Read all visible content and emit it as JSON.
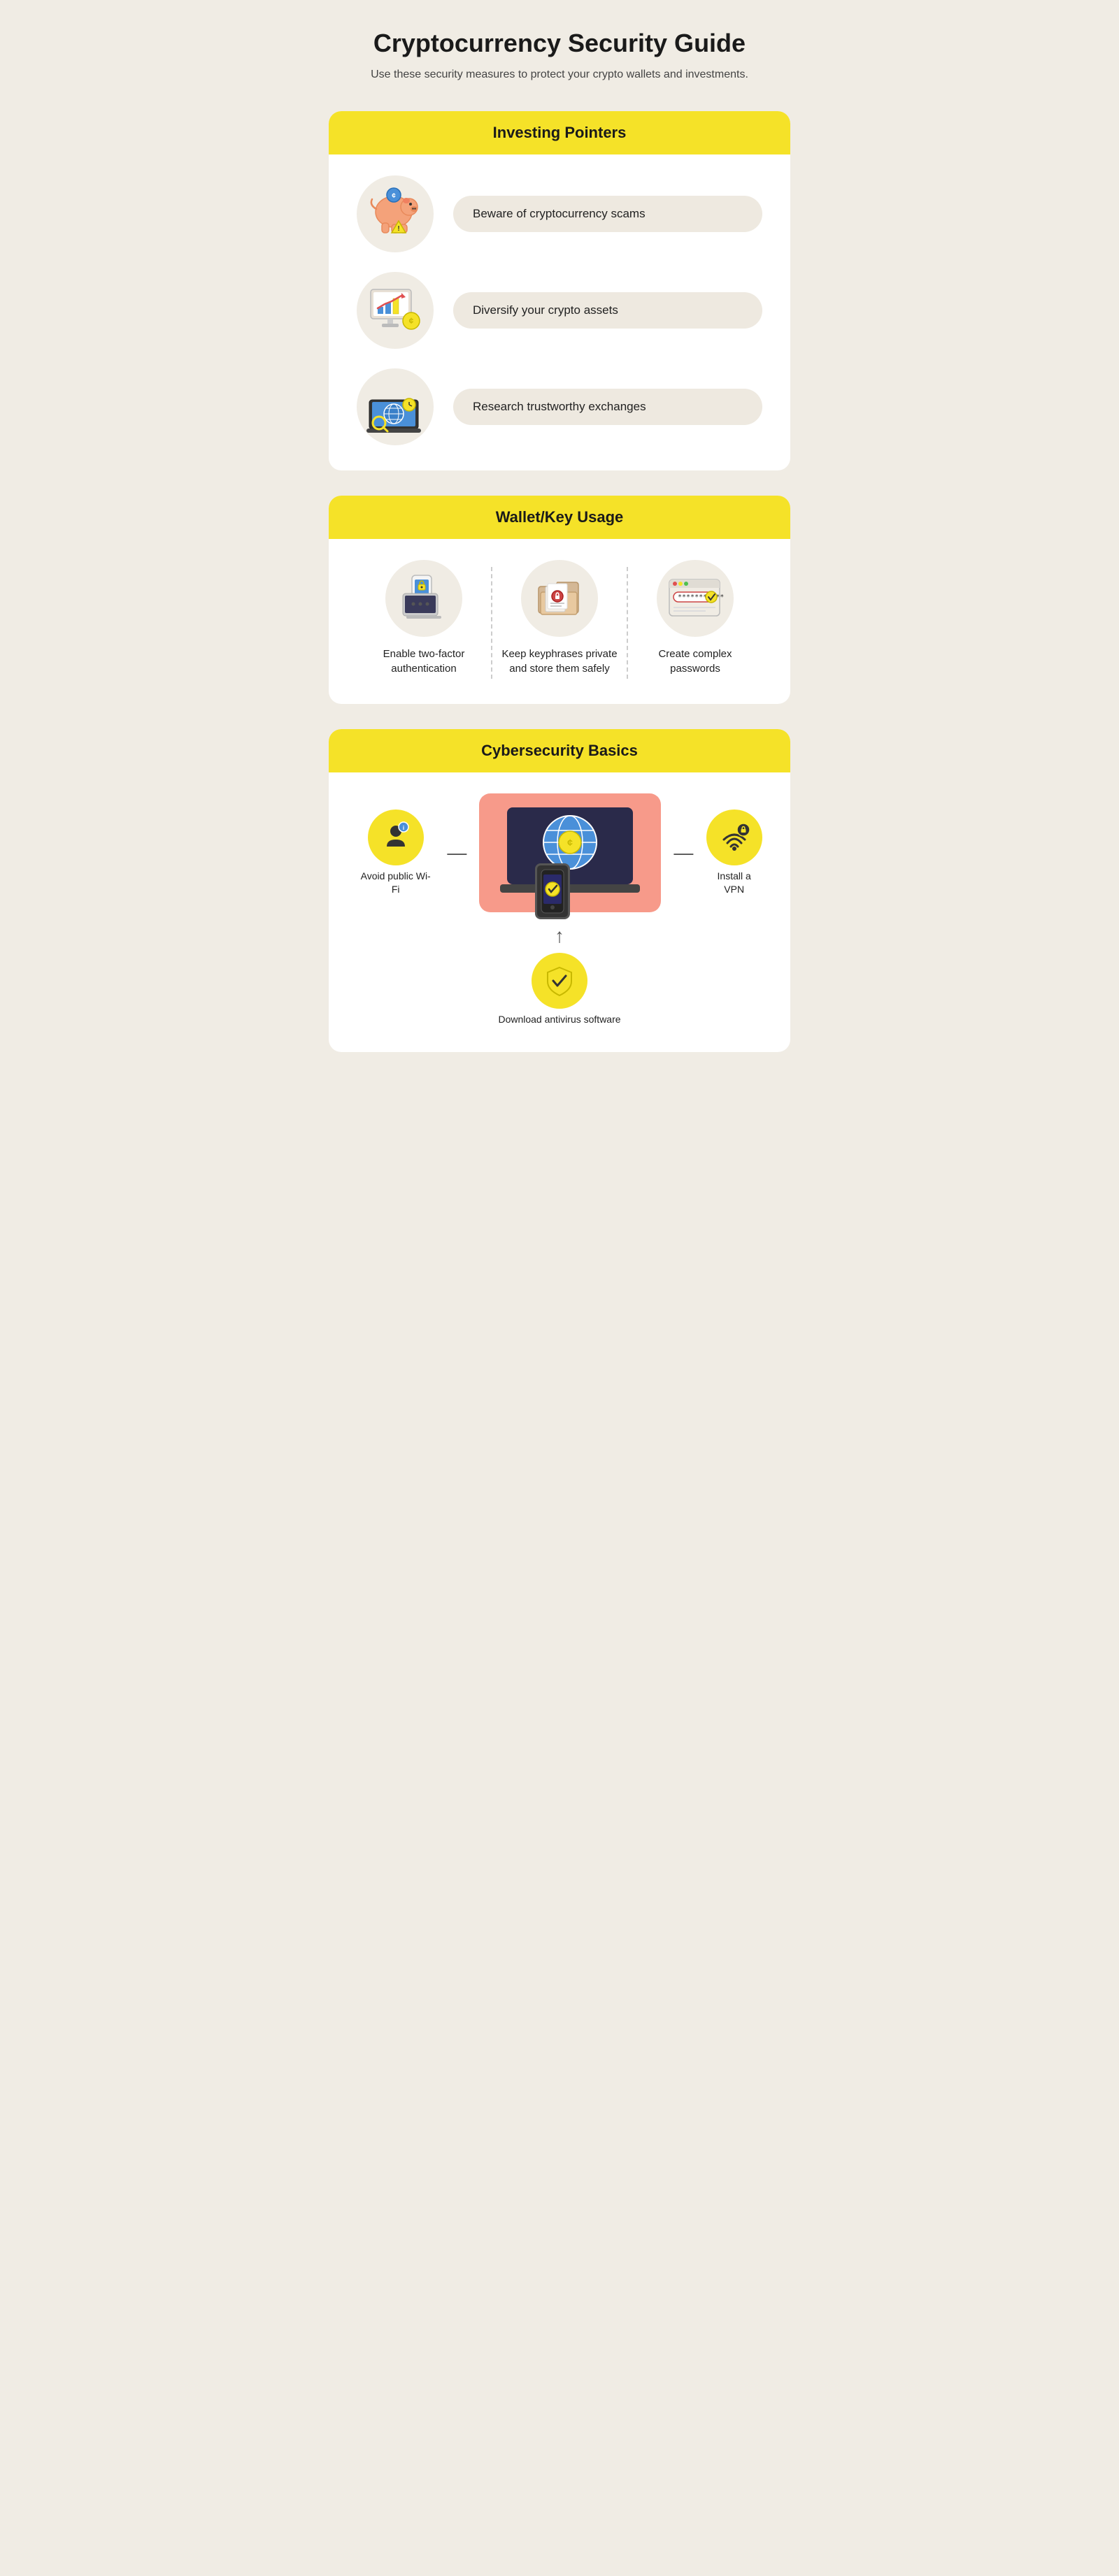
{
  "page": {
    "title": "Cryptocurrency Security Guide",
    "subtitle": "Use these security measures to protect your crypto\nwallets and investments."
  },
  "sections": {
    "investing": {
      "header": "Investing Pointers",
      "items": [
        {
          "label": "Beware of cryptocurrency scams",
          "icon": "piggy-scam-icon"
        },
        {
          "label": "Diversify your crypto assets",
          "icon": "chart-coin-icon"
        },
        {
          "label": "Research trustworthy exchanges",
          "icon": "globe-laptop-icon"
        }
      ]
    },
    "wallet": {
      "header": "Wallet/Key Usage",
      "items": [
        {
          "label": "Enable two-factor authentication",
          "icon": "2fa-icon"
        },
        {
          "label": "Keep keyphrases private and store them safely",
          "icon": "keyphrase-icon"
        },
        {
          "label": "Create complex passwords",
          "icon": "password-icon"
        }
      ]
    },
    "cyber": {
      "header": "Cybersecurity Basics",
      "items": [
        {
          "label": "Avoid\npublic Wi-Fi",
          "icon": "wifi-person-icon",
          "position": "left"
        },
        {
          "label": "Install\na VPN",
          "icon": "wifi-lock-icon",
          "position": "right"
        },
        {
          "label": "Download\nantivirus software",
          "icon": "shield-icon",
          "position": "bottom"
        }
      ]
    }
  }
}
